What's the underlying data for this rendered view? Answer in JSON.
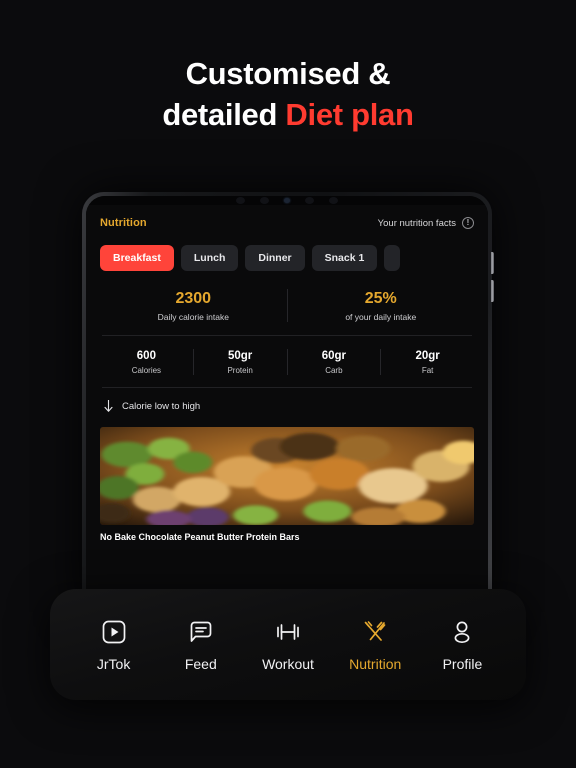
{
  "headline": {
    "line1": "Customised &",
    "line2_plain": "detailed ",
    "line2_accent": "Diet plan"
  },
  "colors": {
    "accent_red": "#ff3b30",
    "accent_gold": "#e5a82e",
    "tab_active": "#ff443a",
    "page_bg": "#0b0b0d",
    "screen_bg": "#0a0a0b"
  },
  "app": {
    "title": "Nutrition",
    "facts_label": "Your nutrition facts",
    "info_icon": "exclamation-circle-icon",
    "meal_tabs": [
      {
        "label": "Breakfast",
        "active": true
      },
      {
        "label": "Lunch",
        "active": false
      },
      {
        "label": "Dinner",
        "active": false
      },
      {
        "label": "Snack 1",
        "active": false
      },
      {
        "label": "",
        "active": false
      }
    ],
    "intake": [
      {
        "value": "2300",
        "label": "Daily calorie intake"
      },
      {
        "value": "25%",
        "label": "of your daily intake"
      }
    ],
    "macros": [
      {
        "value": "600",
        "label": "Calories"
      },
      {
        "value": "50gr",
        "label": "Protein"
      },
      {
        "value": "60gr",
        "label": "Carb"
      },
      {
        "value": "20gr",
        "label": "Fat"
      }
    ],
    "sort": {
      "icon": "arrow-down-icon",
      "label": "Calorie low to high"
    },
    "food_card": {
      "title": "No Bake Chocolate Peanut Butter Protein Bars",
      "image_alt": "plated-food-photo"
    }
  },
  "bottom_nav": [
    {
      "label": "JrTok",
      "icon": "play-square-icon",
      "active": false
    },
    {
      "label": "Feed",
      "icon": "chat-bubble-icon",
      "active": false
    },
    {
      "label": "Workout",
      "icon": "dumbbell-icon",
      "active": false
    },
    {
      "label": "Nutrition",
      "icon": "fork-knife-icon",
      "active": true
    },
    {
      "label": "Profile",
      "icon": "person-icon",
      "active": false
    }
  ]
}
